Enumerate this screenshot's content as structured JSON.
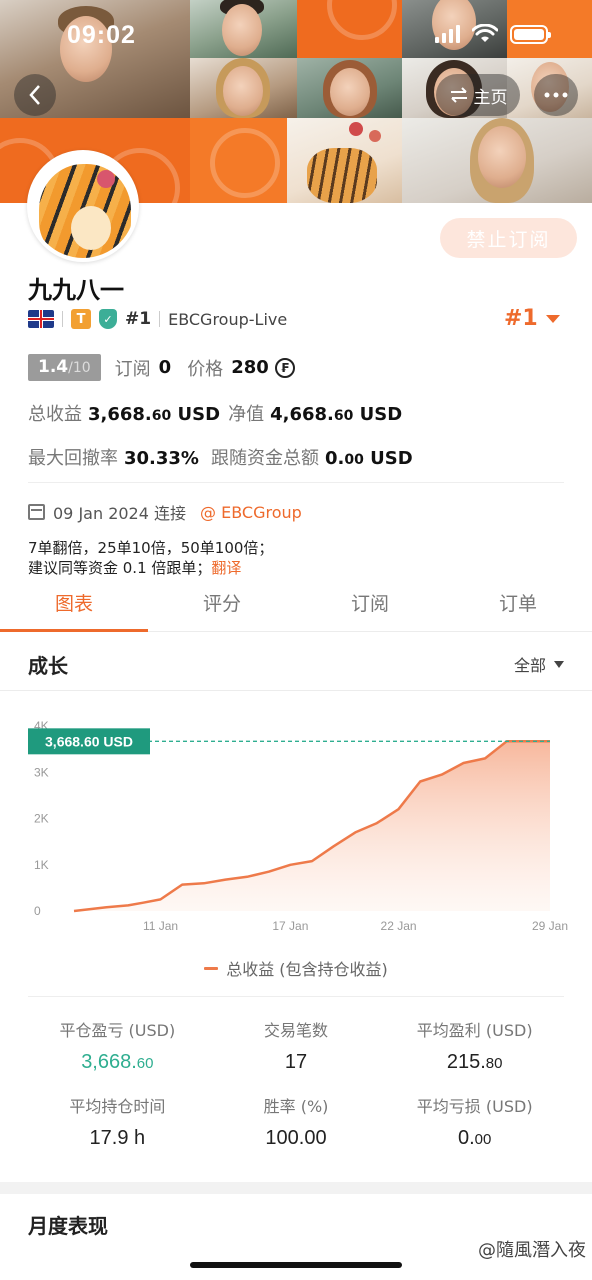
{
  "status_bar": {
    "time": "09:02"
  },
  "header": {
    "home_label": "主页",
    "back_icon": "chevron-left-icon",
    "more_icon": "ellipsis-icon"
  },
  "profile": {
    "name": "九九八一",
    "subscribe_button": "禁止订阅",
    "badge_t": "T",
    "rank_small": "#1",
    "server": "EBCGroup-Live",
    "rank_big": "#1",
    "score": "1.4",
    "score_max": "/10",
    "subscriptions_label": "订阅",
    "subscriptions_value": "0",
    "price_label": "价格",
    "price_value": "280",
    "coin_symbol": "₣",
    "total_profit_label": "总收益",
    "total_profit_main": "3,668.",
    "total_profit_dec": "60",
    "total_profit_unit": "USD",
    "equity_label": "净值",
    "equity_main": "4,668.",
    "equity_dec": "60",
    "equity_unit": "USD",
    "max_drawdown_label": "最大回撤率",
    "max_drawdown_value": "30.33%",
    "follow_funds_label": "跟随资金总额",
    "follow_funds_main": "0.",
    "follow_funds_dec": "00",
    "follow_funds_unit": "USD",
    "connected_date": "09 Jan 2024 连接",
    "broker_link": "@ EBCGroup",
    "description_line1": "7单翻倍，25单10倍，50单100倍；",
    "description_line2": "建议同等资金 0.1 倍跟单；",
    "translate_link": "翻译"
  },
  "tabs": [
    "图表",
    "评分",
    "订阅",
    "订单"
  ],
  "growth": {
    "title": "成长",
    "filter": "全部"
  },
  "chart_data": {
    "type": "area",
    "y_ticks": [
      "0",
      "1K",
      "2K",
      "3K",
      "4K"
    ],
    "x_ticks": [
      "11 Jan",
      "17 Jan",
      "22 Jan",
      "29 Jan"
    ],
    "x_tick_days": [
      11,
      17,
      22,
      29
    ],
    "xlim": [
      7,
      29
    ],
    "ylim": [
      0,
      4000
    ],
    "current_value_label": "3,668.60 USD",
    "current_value": 3668.6,
    "series": [
      {
        "name": "总收益 (包含持仓收益)",
        "color": "#ee7a4a",
        "points": [
          [
            7,
            0
          ],
          [
            8.5,
            80
          ],
          [
            9.5,
            120
          ],
          [
            10.2,
            180
          ],
          [
            11,
            250
          ],
          [
            12,
            570
          ],
          [
            13,
            600
          ],
          [
            14,
            680
          ],
          [
            15,
            740
          ],
          [
            16,
            850
          ],
          [
            17,
            1000
          ],
          [
            18,
            1080
          ],
          [
            19,
            1400
          ],
          [
            20,
            1700
          ],
          [
            21,
            1900
          ],
          [
            22,
            2200
          ],
          [
            23,
            2800
          ],
          [
            24,
            2950
          ],
          [
            25,
            3200
          ],
          [
            26,
            3300
          ],
          [
            27,
            3668.6
          ],
          [
            29,
            3668.6
          ]
        ]
      }
    ]
  },
  "stats": [
    {
      "label": "平仓盈亏 (USD)",
      "main": "3,668.",
      "dec": "60",
      "color": "green"
    },
    {
      "label": "交易笔数",
      "main": "17",
      "dec": "",
      "color": "normal"
    },
    {
      "label": "平均盈利 (USD)",
      "main": "215.",
      "dec": "80",
      "color": "normal"
    },
    {
      "label": "平均持仓时间",
      "main": "17.9 h",
      "dec": "",
      "color": "normal"
    },
    {
      "label": "胜率 (%)",
      "main": "100.00",
      "dec": "",
      "color": "normal"
    },
    {
      "label": "平均亏损 (USD)",
      "main": "0.",
      "dec": "00",
      "color": "normal"
    }
  ],
  "monthly_title": "月度表现",
  "watermark": "@隨風潛入夜"
}
